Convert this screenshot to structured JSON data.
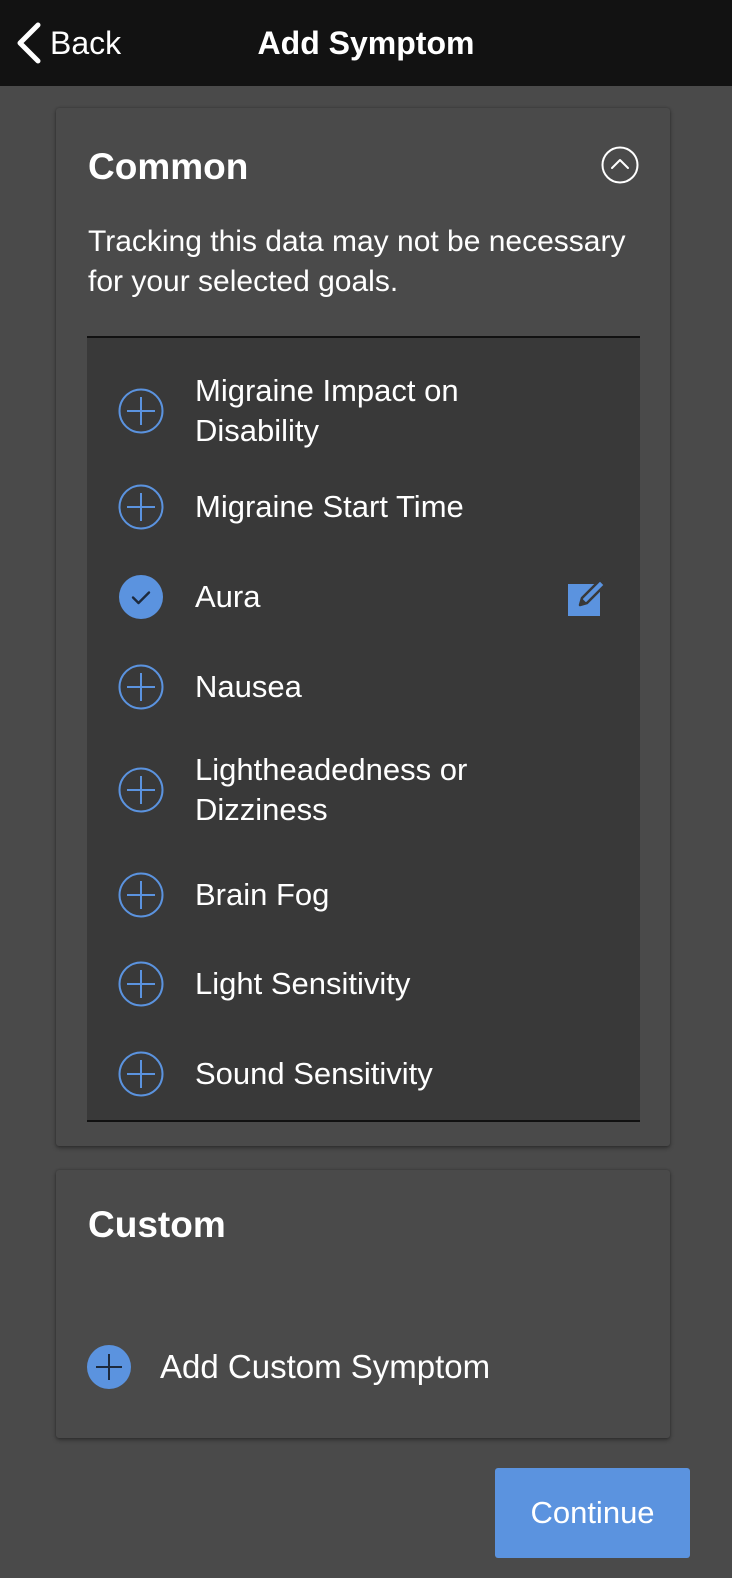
{
  "header": {
    "back_label": "Back",
    "title": "Add Symptom"
  },
  "common": {
    "title": "Common",
    "note": "Tracking this data may not be necessary for your selected goals.",
    "items": [
      {
        "label": "Migraine Impact on Disability",
        "selected": false
      },
      {
        "label": "Migraine Start Time",
        "selected": false
      },
      {
        "label": "Aura",
        "selected": true
      },
      {
        "label": "Nausea",
        "selected": false
      },
      {
        "label": "Lightheadedness or Dizziness",
        "selected": false
      },
      {
        "label": "Brain Fog",
        "selected": false
      },
      {
        "label": "Light Sensitivity",
        "selected": false
      },
      {
        "label": "Sound Sensitivity",
        "selected": false
      }
    ]
  },
  "custom": {
    "title": "Custom",
    "add_label": "Add Custom Symptom"
  },
  "footer": {
    "continue_label": "Continue"
  },
  "colors": {
    "accent": "#5b93df",
    "header_bg": "#121212",
    "page_bg": "#4a4a4a",
    "list_bg": "#393939"
  },
  "icons": {
    "back": "chevron-left-icon",
    "collapse": "chevron-up-circle-icon",
    "add": "plus-circle-icon",
    "selected": "check-circle-icon",
    "edit": "pencil-icon"
  }
}
